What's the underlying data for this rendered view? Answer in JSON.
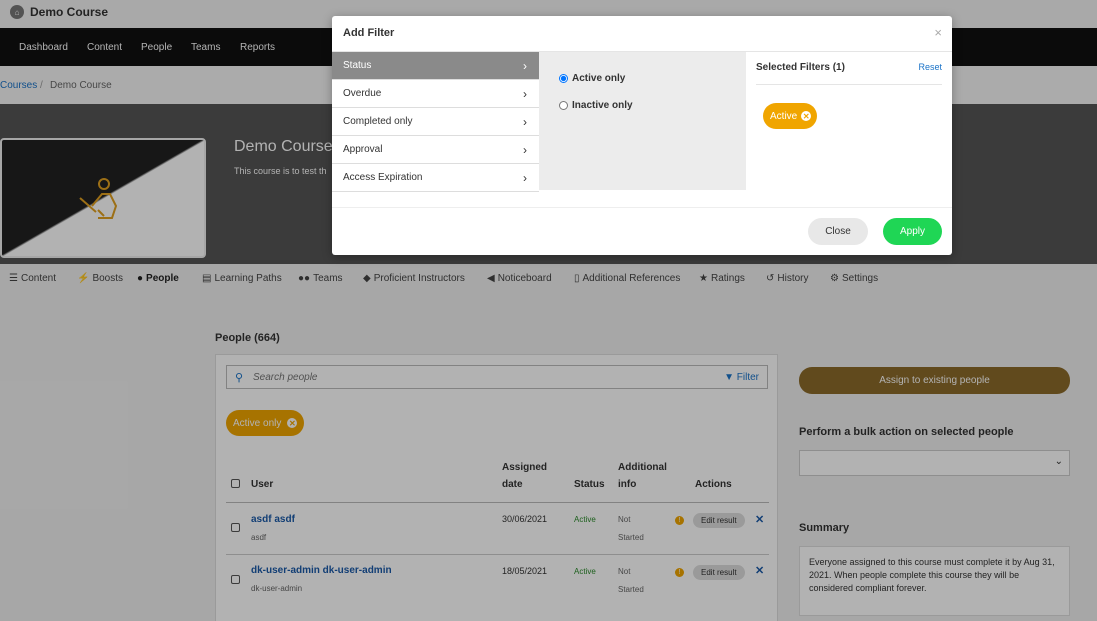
{
  "app": {
    "title": "Demo Course"
  },
  "nav": [
    "Dashboard",
    "Content",
    "People",
    "Teams",
    "Reports"
  ],
  "breadcrumb": {
    "root": "Courses",
    "sep": "/",
    "current": "Demo Course"
  },
  "hero": {
    "title": "Demo Course",
    "description": "This course is to test th"
  },
  "tabs": [
    {
      "icon": "☰",
      "label": "Content"
    },
    {
      "icon": "⚡",
      "label": "Boosts"
    },
    {
      "icon": "●",
      "label": "People"
    },
    {
      "icon": "▤",
      "label": "Learning Paths"
    },
    {
      "icon": "●●",
      "label": "Teams"
    },
    {
      "icon": "◆",
      "label": "Proficient Instructors"
    },
    {
      "icon": "◀",
      "label": "Noticeboard"
    },
    {
      "icon": "▯",
      "label": "Additional References"
    },
    {
      "icon": "★",
      "label": "Ratings"
    },
    {
      "icon": "↺",
      "label": "History"
    },
    {
      "icon": "⚙",
      "label": "Settings"
    }
  ],
  "people": {
    "title": "People (664)",
    "search_placeholder": "Search people",
    "filter_label": "Filter",
    "active_chip": "Active only",
    "headers": {
      "user": "User",
      "assigned_1": "Assigned",
      "assigned_2": "date",
      "status": "Status",
      "info_1": "Additional",
      "info_2": "info",
      "actions": "Actions"
    },
    "rows": [
      {
        "name": "asdf asdf",
        "sub": "asdf",
        "date": "30/06/2021",
        "status": "Active",
        "info_1": "Not",
        "info_2": "Started",
        "action": "Edit result"
      },
      {
        "name": "dk-user-admin dk-user-admin",
        "sub": "dk-user-admin",
        "date": "18/05/2021",
        "status": "Active",
        "info_1": "Not",
        "info_2": "Started",
        "action": "Edit result"
      }
    ]
  },
  "sidebar": {
    "assign_label": "Assign to existing people",
    "bulk_label": "Perform a bulk action on selected people",
    "summary_label": "Summary",
    "summary_text": "Everyone assigned to this course must complete it by Aug 31, 2021. When people complete this course they will be considered compliant forever."
  },
  "modal": {
    "title": "Add Filter",
    "close_icon": "×",
    "categories": [
      "Status",
      "Overdue",
      "Completed only",
      "Approval",
      "Access Expiration"
    ],
    "options": [
      "Active only",
      "Inactive only"
    ],
    "selected_title": "Selected Filters (1)",
    "reset_label": "Reset",
    "selected_chip": "Active",
    "close_label": "Close",
    "apply_label": "Apply"
  },
  "colors": {
    "accent": "#f0a500",
    "apply": "#1fd655",
    "link": "#1a73c8",
    "assign": "#8c6a2a"
  }
}
